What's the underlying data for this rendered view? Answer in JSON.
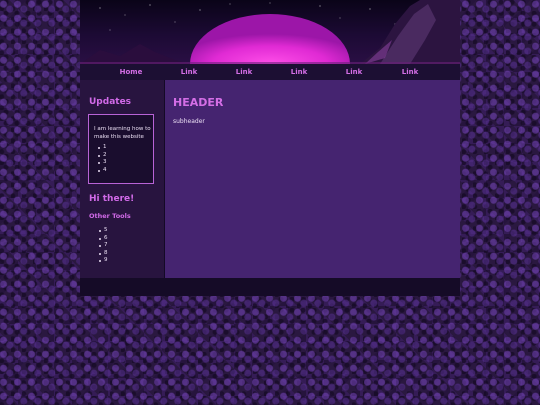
{
  "nav": {
    "items": [
      {
        "label": "Home"
      },
      {
        "label": "Link"
      },
      {
        "label": "Link"
      },
      {
        "label": "Link"
      },
      {
        "label": "Link"
      },
      {
        "label": "Link"
      }
    ]
  },
  "sidebar": {
    "updates_heading": "Updates",
    "updates_text": "I am learning how to make this website",
    "updates_list": [
      "1",
      "2",
      "3",
      "4"
    ],
    "greeting": "Hi there!",
    "other_tools_heading": "Other Tools",
    "tools_list": [
      "5",
      "6",
      "7",
      "8",
      "9"
    ]
  },
  "main": {
    "header": "HEADER",
    "subheader": "subheader"
  },
  "colors": {
    "accent": "#d46ee6",
    "content_bg": "#452470",
    "sidebar_bg": "#28143f",
    "nav_bg": "#1c0f33",
    "sun": "#e834d8"
  }
}
